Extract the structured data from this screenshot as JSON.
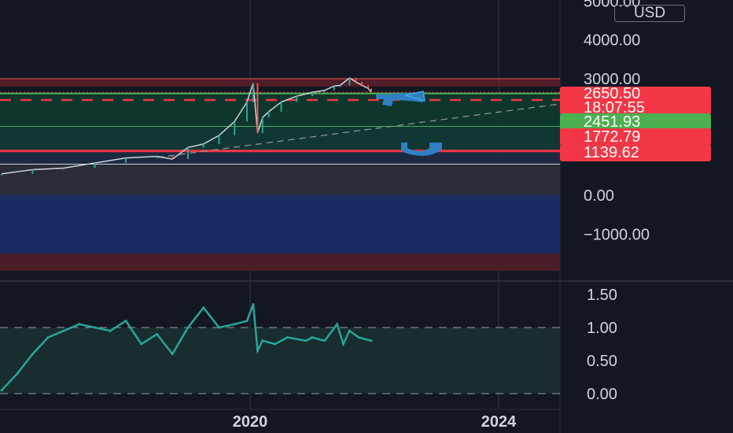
{
  "currency": "USD",
  "colors": {
    "background": "#131722",
    "up": "#26a69a",
    "down": "#ef5350",
    "resistance": "#f23645",
    "support": "#4caf50",
    "oscillator": "#26a69a",
    "marker": "#2962ff"
  },
  "price_tags": {
    "last_price": "2650.50",
    "countdown": "18:07:55",
    "level_green": "2451.93",
    "level_red_1": "1772.79",
    "level_red_2": "1139.62"
  },
  "chart_data": [
    {
      "type": "line",
      "pane": "price",
      "y_axis_ticks": [
        "5000.00",
        "4000.00",
        "3000.00",
        "0.00",
        "−1000.00"
      ],
      "x_axis_ticks": [
        "2020",
        "2024"
      ],
      "ylim": [
        -1700,
        5100
      ],
      "xlim": [
        2015.95,
        2025.05
      ],
      "x": [
        2016.0,
        2016.5,
        2017.0,
        2017.5,
        2018.0,
        2018.5,
        2018.75,
        2019.0,
        2019.25,
        2019.5,
        2019.75,
        2019.95,
        2020.05,
        2020.12,
        2020.2,
        2020.3,
        2020.5,
        2020.75,
        2021.0,
        2021.2,
        2021.35,
        2021.45,
        2021.6,
        2021.7,
        2021.8,
        2021.9,
        2021.95
      ],
      "series": [
        {
          "values": [
            550,
            660,
            700,
            830,
            960,
            1000,
            930,
            1230,
            1320,
            1540,
            1900,
            2400,
            2890,
            1600,
            2000,
            2150,
            2400,
            2550,
            2650,
            2700,
            2810,
            2830,
            3020,
            2920,
            2830,
            2750,
            2650.5
          ]
        }
      ],
      "levels": [
        3000,
        2800,
        2650.5,
        2620,
        2451.93,
        1772.79,
        1139.62,
        800,
        -1500
      ],
      "grid": true
    },
    {
      "type": "line",
      "pane": "oscillator",
      "y_axis_ticks": [
        "1.50",
        "1.00",
        "0.50",
        "0.00"
      ],
      "ylim": [
        -0.05,
        1.65
      ],
      "dashed_levels": [
        1.0,
        0.0
      ],
      "x": [
        2016.0,
        2016.25,
        2016.5,
        2016.75,
        2017.0,
        2017.25,
        2017.5,
        2017.75,
        2018.0,
        2018.25,
        2018.5,
        2018.75,
        2019.0,
        2019.25,
        2019.5,
        2019.75,
        2019.95,
        2020.05,
        2020.12,
        2020.2,
        2020.4,
        2020.6,
        2020.9,
        2021.0,
        2021.2,
        2021.4,
        2021.5,
        2021.6,
        2021.75,
        2021.95
      ],
      "series": [
        {
          "values": [
            0.05,
            0.3,
            0.6,
            0.85,
            0.95,
            1.05,
            1.0,
            0.95,
            1.1,
            0.75,
            0.9,
            0.6,
            1.0,
            1.3,
            1.0,
            1.05,
            1.1,
            1.35,
            0.65,
            0.8,
            0.75,
            0.85,
            0.8,
            0.85,
            0.8,
            1.05,
            0.75,
            0.95,
            0.85,
            0.8
          ]
        }
      ]
    }
  ]
}
